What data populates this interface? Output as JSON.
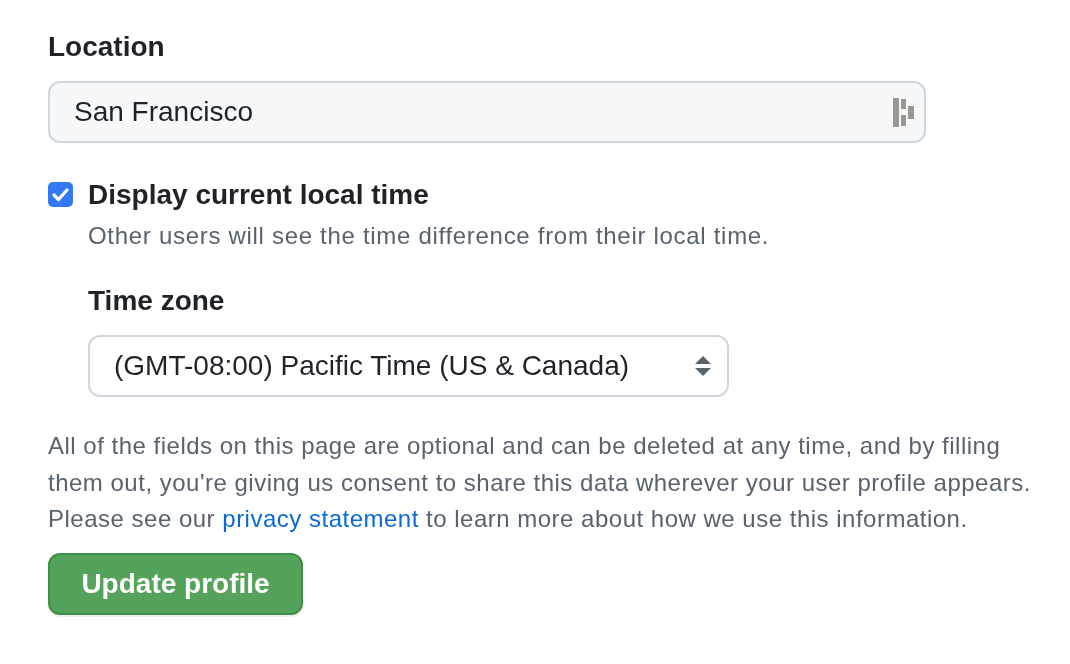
{
  "location": {
    "label": "Location",
    "value": "San Francisco"
  },
  "local_time": {
    "label": "Display current local time",
    "checked": true,
    "description": "Other users will see the time difference from their local time."
  },
  "time_zone": {
    "label": "Time zone",
    "value": "(GMT-08:00) Pacific Time (US & Canada)"
  },
  "note": {
    "text_before": "All of the fields on this page are optional and can be deleted at any time, and by filling them out, you're giving us consent to share this data wherever your user profile appears. Please see our ",
    "link": "privacy statement",
    "text_after": " to learn more about how we use this information."
  },
  "buttons": [
    {
      "label": "Update profile",
      "kind": "primary"
    }
  ]
}
